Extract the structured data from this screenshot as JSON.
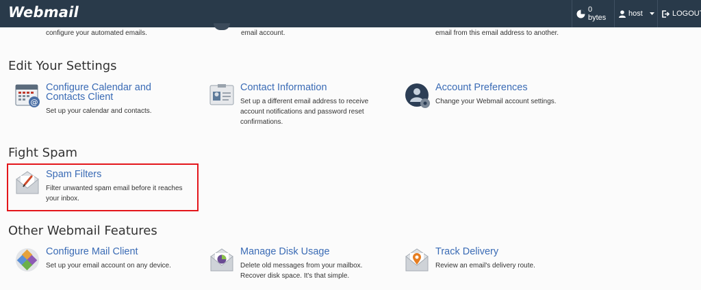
{
  "header": {
    "logo": "Webmail",
    "disk_usage": "0 bytes",
    "user": "host",
    "logout": "LOGOUT"
  },
  "partial_row": [
    {
      "desc": "configure your automated emails."
    },
    {
      "desc": "email account."
    },
    {
      "desc": "email from this email address to another."
    }
  ],
  "sections": {
    "settings": {
      "title": "Edit Your Settings",
      "items": [
        {
          "title_line1": "Configure Calendar and",
          "title_line2": "Contacts Client",
          "desc": "Set up your calendar and contacts."
        },
        {
          "title": "Contact Information",
          "desc_line1": "Set up a different email address to receive",
          "desc_line2": "account notifications and password reset",
          "desc_line3": "confirmations."
        },
        {
          "title": "Account Preferences",
          "desc": "Change your Webmail account settings."
        }
      ]
    },
    "spam": {
      "title": "Fight Spam",
      "items": [
        {
          "title": "Spam Filters",
          "desc_line1": "Filter unwanted spam email before it reaches",
          "desc_line2": "your inbox."
        }
      ]
    },
    "other": {
      "title": "Other Webmail Features",
      "items": [
        {
          "title": "Configure Mail Client",
          "desc": "Set up your email account on any device."
        },
        {
          "title": "Manage Disk Usage",
          "desc_line1": "Delete old messages from your mailbox.",
          "desc_line2": "Recover disk space. It's that simple."
        },
        {
          "title": "Track Delivery",
          "desc": "Review an email's delivery route."
        }
      ]
    }
  },
  "colors": {
    "topbar": "#293a4a",
    "link": "#3a6bb5",
    "highlight": "#e3151a"
  },
  "icons": {
    "disk": "pie-chart-icon",
    "user": "user-icon",
    "logout": "logout-icon"
  }
}
